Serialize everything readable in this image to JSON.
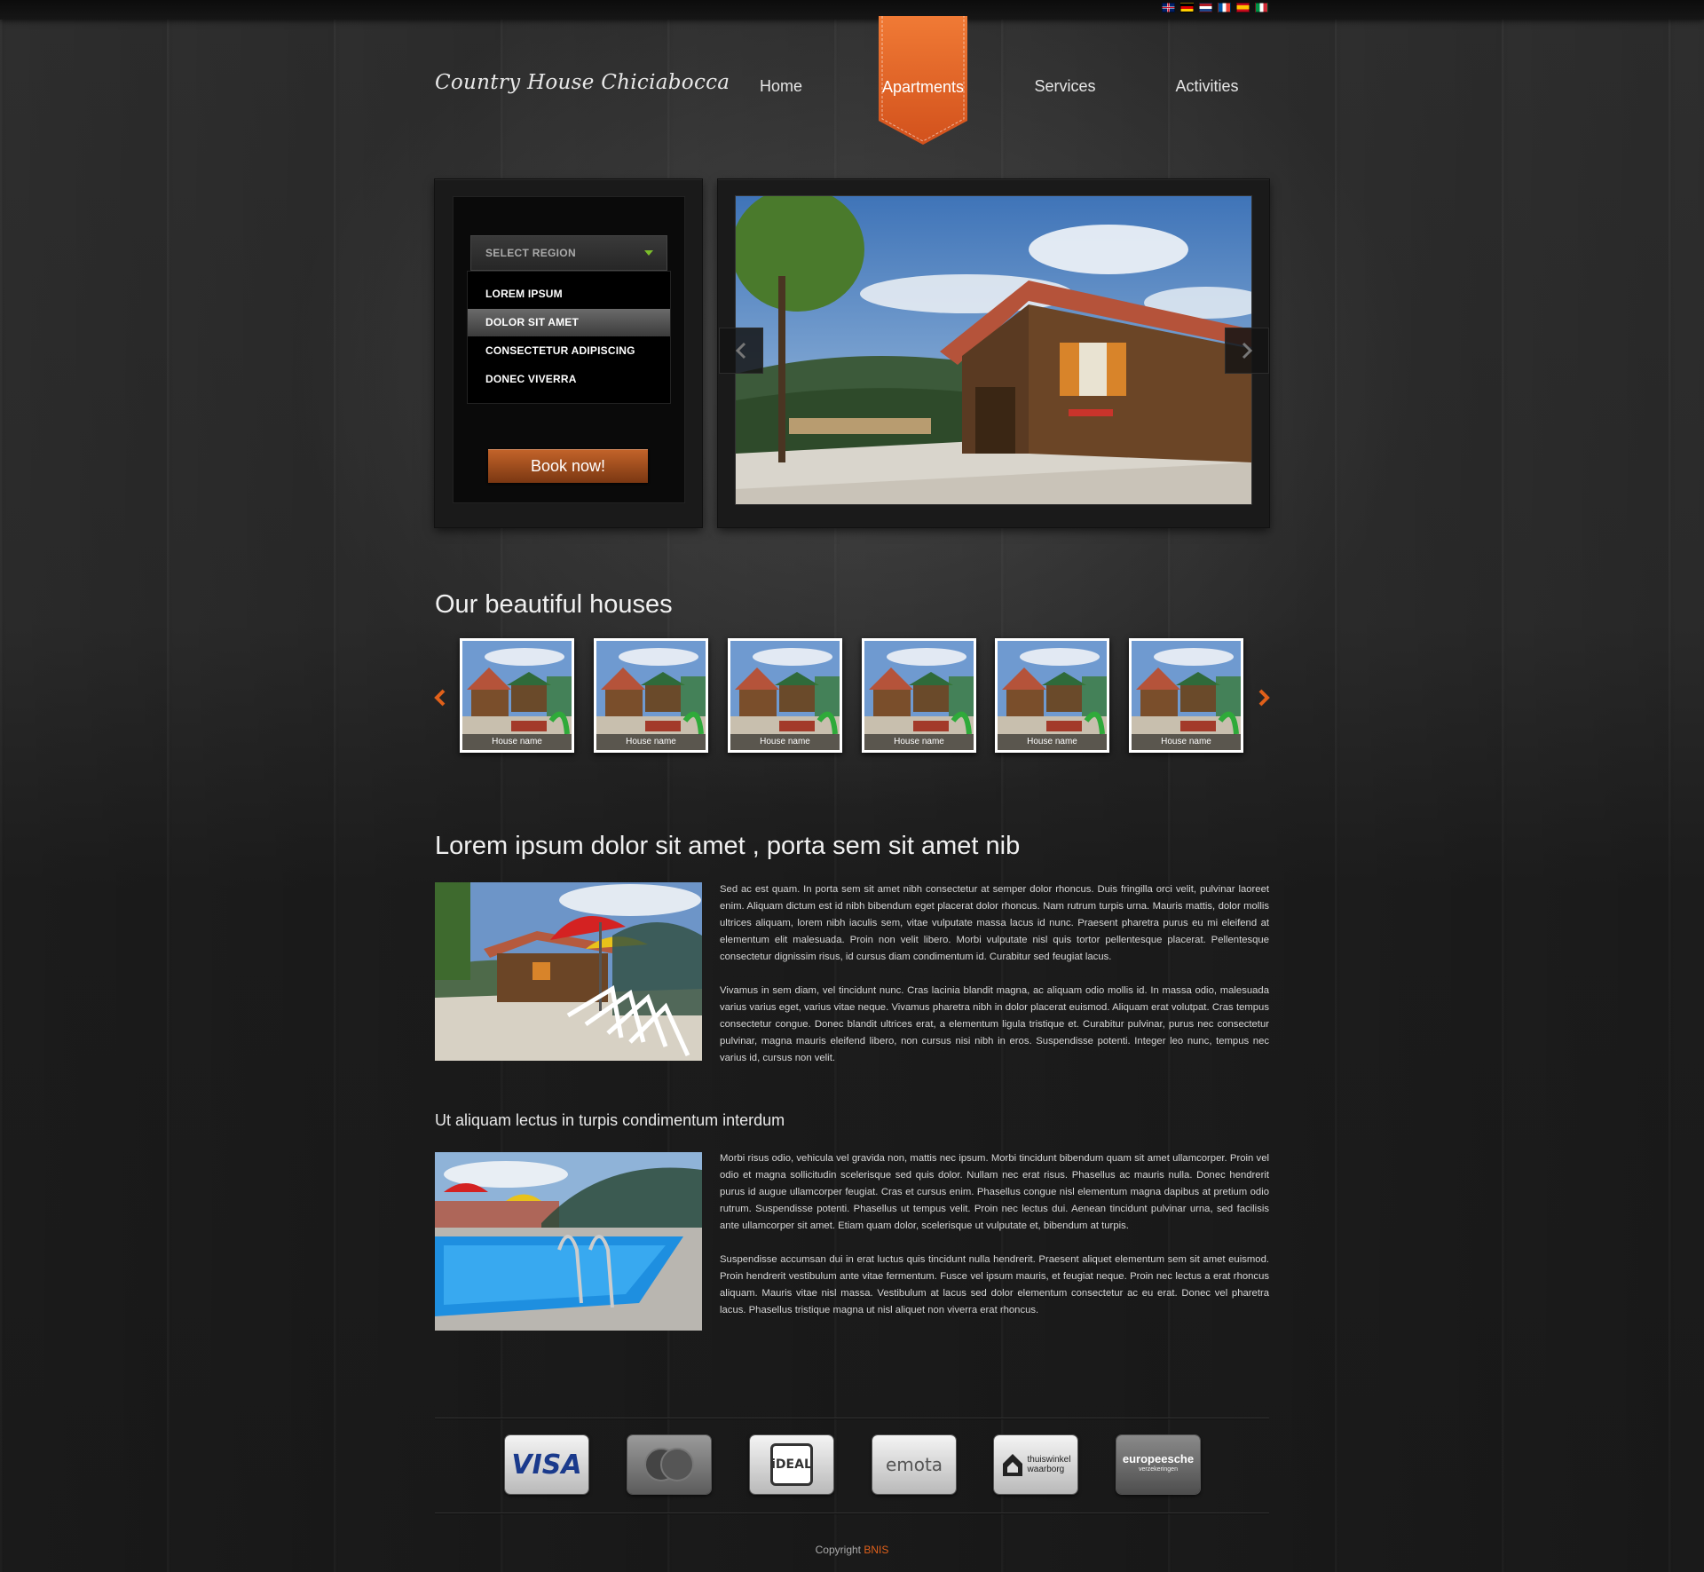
{
  "header": {
    "languages": [
      "English",
      "Deutsch",
      "Nederlands",
      "Français",
      "Español",
      "Italiano"
    ],
    "logo_text": "Country House Chiciabocca",
    "nav": [
      {
        "label": "Home",
        "active": false
      },
      {
        "label": "Apartments",
        "active": true
      },
      {
        "label": "Services",
        "active": false
      },
      {
        "label": "Activities",
        "active": false
      }
    ]
  },
  "booking": {
    "select_placeholder": "SELECT REGION",
    "options": [
      "LOREM IPSUM",
      "DOLOR SIT AMET",
      "CONSECTETUR ADIPISCING",
      "DONEC VIVERRA"
    ],
    "selected_option": "DOLOR SIT AMET",
    "book_label": "Book now!"
  },
  "slider": {
    "prev_icon": "chevron-left-icon",
    "next_icon": "chevron-right-icon"
  },
  "houses": {
    "title": "Our beautiful houses",
    "items": [
      "House name",
      "House name",
      "House name",
      "House name",
      "House name",
      "House name"
    ],
    "prev_icon": "chevron-left-icon",
    "next_icon": "chevron-right-icon"
  },
  "article1": {
    "title": "Lorem ipsum dolor sit amet , porta sem sit amet nib",
    "paragraphs": [
      "Sed ac est quam. In porta sem sit amet nibh consectetur at semper dolor rhoncus. Duis fringilla orci velit, pulvinar laoreet enim. Aliquam dictum est id nibh bibendum eget placerat dolor rhoncus. Nam rutrum turpis urna. Mauris mattis, dolor mollis ultrices aliquam, lorem nibh iaculis sem, vitae vulputate massa lacus id nunc. Praesent pharetra purus eu mi eleifend at elementum elit malesuada. Proin non velit libero. Morbi vulputate nisl quis tortor pellentesque placerat. Pellentesque consectetur dignissim risus, id cursus diam condimentum id. Curabitur sed feugiat lacus.",
      "Vivamus in sem diam, vel tincidunt nunc. Cras lacinia blandit magna, ac aliquam odio mollis id. In massa odio, malesuada varius varius eget, varius vitae neque. Vivamus pharetra nibh in dolor placerat euismod. Aliquam erat volutpat. Cras tempus consectetur congue. Donec blandit ultrices erat, a elementum ligula tristique et. Curabitur pulvinar, purus nec consectetur pulvinar, magna mauris eleifend libero, non cursus nisi nibh in eros. Suspendisse potenti. Integer leo nunc, tempus nec varius id, cursus non velit."
    ]
  },
  "article2": {
    "title": "Ut aliquam lectus in turpis condimentum interdum",
    "paragraphs": [
      "Morbi risus odio, vehicula vel gravida non, mattis nec ipsum. Morbi tincidunt bibendum quam sit amet ullamcorper. Proin vel odio et magna sollicitudin scelerisque sed quis dolor. Nullam nec erat risus. Phasellus ac mauris nulla. Donec hendrerit purus id augue ullamcorper feugiat. Cras et cursus enim. Phasellus congue nisl elementum magna dapibus at pretium odio rutrum. Suspendisse potenti. Phasellus ut tempus velit. Proin nec lectus dui. Aenean tincidunt pulvinar urna, sed facilisis ante ullamcorper sit amet. Etiam quam dolor, scelerisque ut vulputate et, bibendum at turpis.",
      "Suspendisse accumsan dui in erat luctus quis tincidunt nulla hendrerit. Praesent aliquet elementum sem sit amet euismod. Proin hendrerit vestibulum ante vitae fermentum. Fusce vel ipsum mauris, et feugiat neque. Proin nec lectus a erat rhoncus aliquam. Mauris vitae nisl massa. Vestibulum at lacus sed dolor elementum consectetur ac eu erat. Donec vel pharetra lacus. Phasellus tristique magna ut nisl aliquet non viverra erat rhoncus."
    ]
  },
  "payments": {
    "visa": "VISA",
    "mastercard": "mastercard-icon",
    "ideal": "iDEAL",
    "emota": "emota",
    "thuiswinkel_line1": "thuiswinkel",
    "thuiswinkel_line2": "waarborg",
    "europeesche_line1": "europeesche",
    "europeesche_line2": "verzekeringen"
  },
  "footer": {
    "copyright_label": "Copyright",
    "brand": "BNIS"
  },
  "colors": {
    "accent": "#e8652a",
    "background": "#2a2a2a",
    "select_arrow": "#7bbd2b"
  }
}
